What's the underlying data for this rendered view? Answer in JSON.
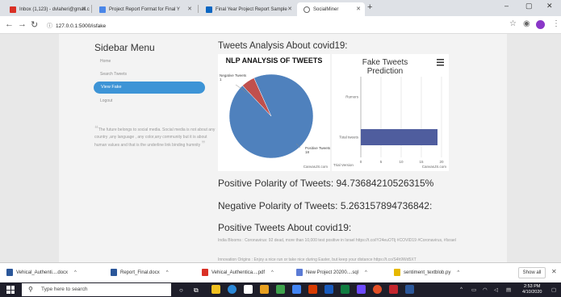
{
  "browser": {
    "tabs": [
      {
        "label": "Inbox (1,123) - dvlaheri@gmail.c",
        "icon": "gmail-icon",
        "color": "#d93025"
      },
      {
        "label": "Project Report Format for Final Y",
        "icon": "doc-icon",
        "color": "#4a86e8"
      },
      {
        "label": "Final Year Project Report Sample",
        "icon": "linkedin-icon",
        "color": "#0a66c2"
      },
      {
        "label": "SocialMiner",
        "icon": "globe-icon",
        "color": "#666666"
      }
    ],
    "url": "127.0.0.1:5000/isfake"
  },
  "sidebar": {
    "title": "Sidebar Menu",
    "items": [
      {
        "label": "Home"
      },
      {
        "label": "Search Tweets"
      },
      {
        "label": "View Fake",
        "active": true
      },
      {
        "label": "Logout"
      }
    ],
    "quote": "The future belongs to social media. Social media is not about any country ,any language , any color,any community but it is about human values and that is the underline link binding humnity"
  },
  "main": {
    "title": "Tweets Analysis About covid19:",
    "positive_polarity": "Positive Polarity of Tweets: 94.73684210526315%",
    "negative_polarity": "Negative Polarity of Tweets: 5.263157894736842:",
    "positive_title": "Positive Tweets About covid19:",
    "tweets": [
      "India Blooms : Coronavirus: 92 dead, more than 10,000 test positive in Israel https://t.co/iY24euOTIj #COVID19 #Coronavirus, #Israel",
      "Innovation Origins : Enjoy a nice run or take nice during Easter, but keep your distance https://t.co/S4h9Wd5XT"
    ]
  },
  "chart_data": [
    {
      "type": "pie",
      "title": "NLP ANALYSIS OF TWEETS",
      "categories": [
        "Negative Tweets",
        "Positive Tweets"
      ],
      "values": [
        1,
        18
      ],
      "labels": [
        "Negative Tweets 1",
        "Positive Tweets 18"
      ],
      "colors": [
        "#c0504d",
        "#4f81bd"
      ],
      "credit": "CanvasJS.com"
    },
    {
      "type": "bar",
      "title": "Fake Tweets Prediction",
      "categories": [
        "Rumors",
        "Total tweets"
      ],
      "values": [
        0,
        19
      ],
      "xticks": [
        "0",
        "5",
        "10",
        "15",
        "20"
      ],
      "xlim": [
        0,
        20
      ],
      "colors": [
        "#4f5d9e"
      ],
      "extra_label": "Trial Version",
      "credit": "CanvasJS.com"
    }
  ],
  "downloads": [
    {
      "label": "Vehical_Authenti....docx",
      "color": "#2b579a"
    },
    {
      "label": "Report_Final.docx",
      "color": "#2b579a"
    },
    {
      "label": "Vehical_Authentica....pdf",
      "color": "#d93025"
    },
    {
      "label": "New Project 20200....sql",
      "color": "#5b7bd5"
    },
    {
      "label": "sentiment_textblob.py",
      "color": "#e6b800"
    }
  ],
  "download_show_all": "Show all",
  "taskbar": {
    "search_placeholder": "Type here to search",
    "time": "2:53 PM",
    "date": "4/10/2020"
  }
}
